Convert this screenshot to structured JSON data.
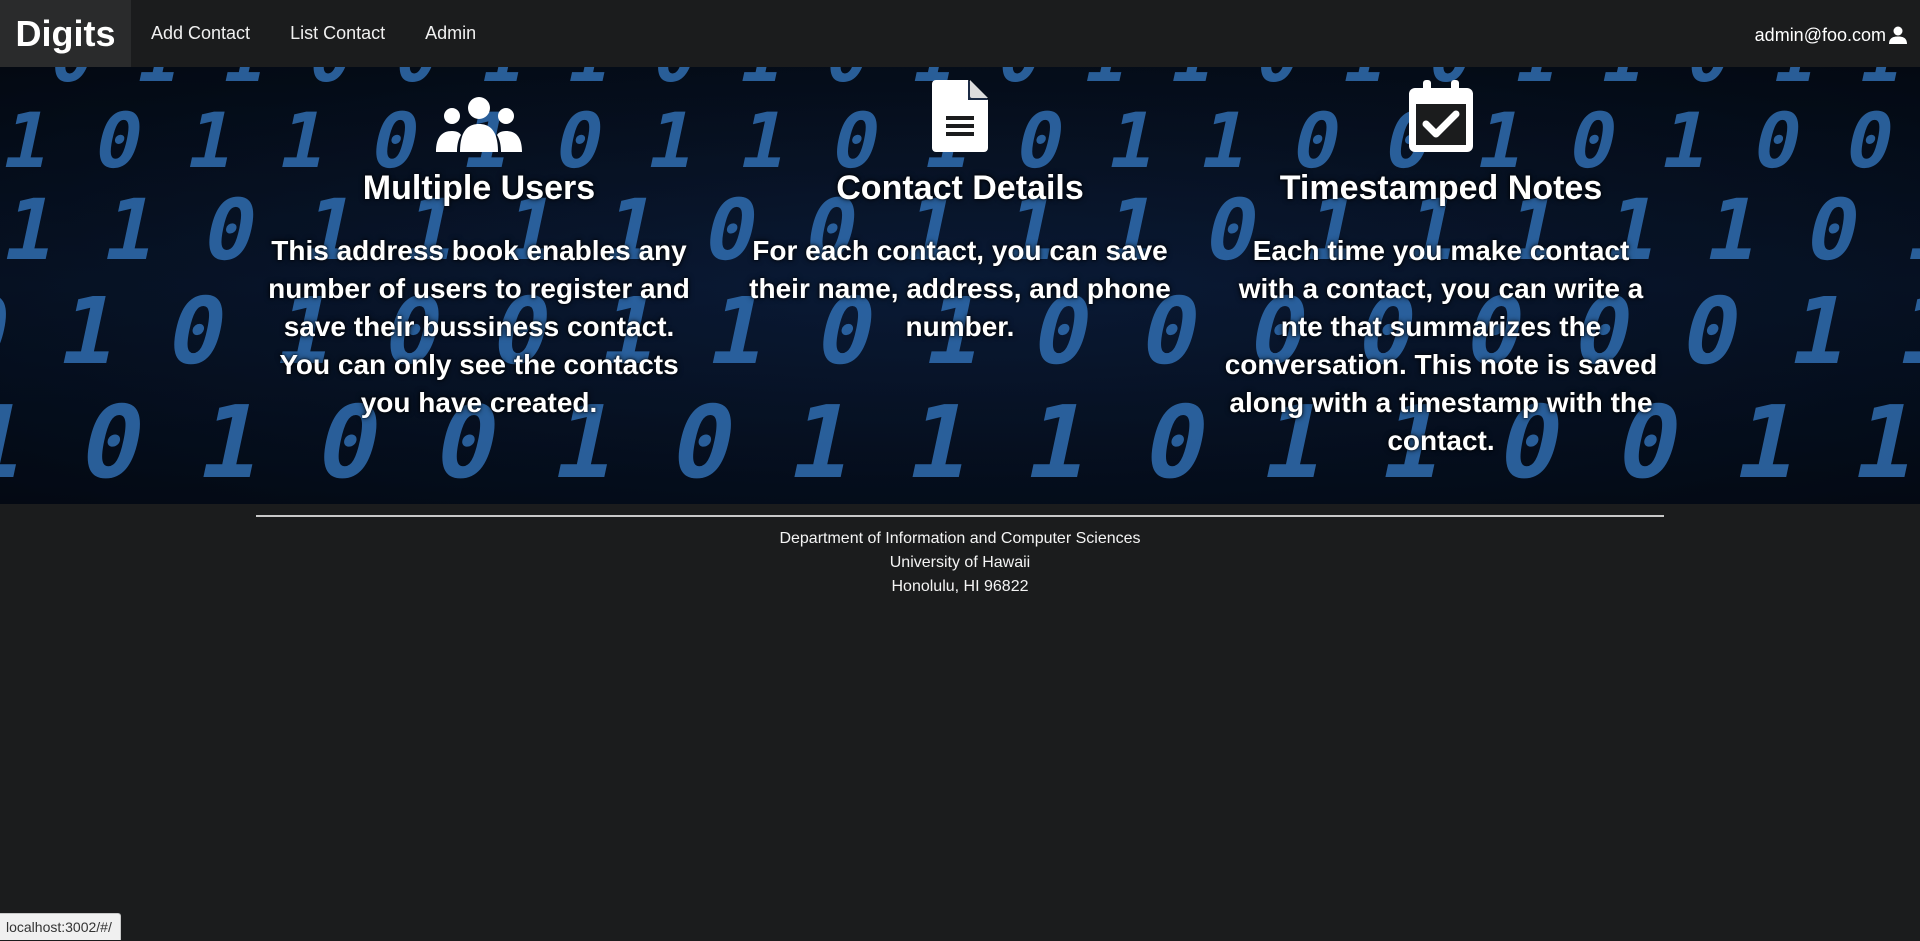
{
  "nav": {
    "brand": "Digits",
    "items": [
      "Add Contact",
      "List Contact",
      "Admin"
    ],
    "user": "admin@foo.com",
    "user_icon": "user-icon"
  },
  "features": [
    {
      "icon": "users-icon",
      "title": "Multiple Users",
      "text": "This address book enables any number of users to register and save their bussiness contact. You can only see the contacts you have created."
    },
    {
      "icon": "file-text-icon",
      "title": "Contact Details",
      "text": "For each contact, you can save their name, address, and phone number."
    },
    {
      "icon": "calendar-check-icon",
      "title": "Timestamped Notes",
      "text": "Each time you make contact with a contact, you can write a nte that summarizes the conversation. This note is saved along with a timestamp with the contact."
    }
  ],
  "footer": {
    "line1": "Department of Information and Computer Sciences",
    "line2": "University of Hawaii",
    "line3": "Honolulu, HI 96822"
  },
  "status_bar": "localhost:3002/#/",
  "colors": {
    "background": "#1b1c1d",
    "binary_digits": "#3f8fe6"
  }
}
